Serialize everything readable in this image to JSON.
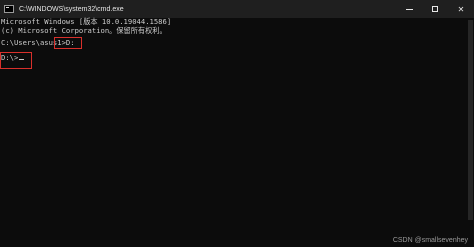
{
  "window": {
    "title": "C:\\WINDOWS\\system32\\cmd.exe",
    "icon": "cmd-icon",
    "controls": {
      "minimize": "minimize-icon",
      "maximize": "maximize-icon",
      "close_label": "✕"
    }
  },
  "console": {
    "lines": [
      "Microsoft Windows [版本 10.0.19044.1586]",
      "(c) Microsoft Corporation。保留所有权利。",
      "",
      "C:\\Users\\asus1>D:",
      "",
      "D:\\>"
    ],
    "command": "D:",
    "cursor": "_"
  },
  "highlight_color": "#d9302b",
  "watermark": "CSDN @smallsevenhey"
}
